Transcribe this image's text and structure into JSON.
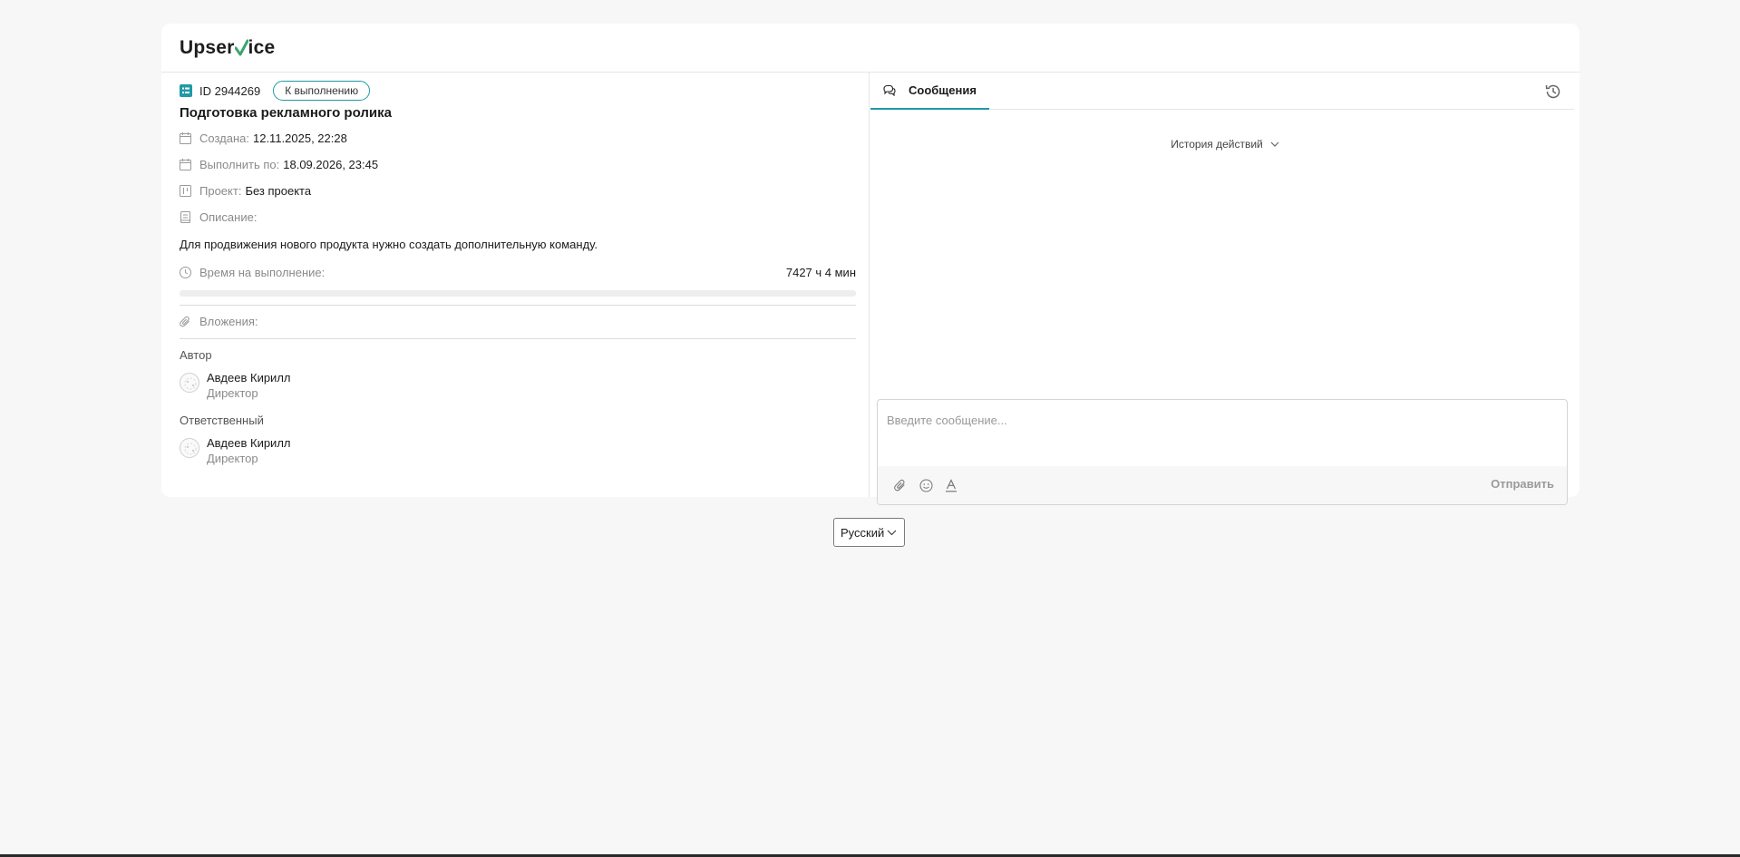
{
  "logo": {
    "text_before": "Upser",
    "text_after": "ice",
    "check_color": "#3aa76d"
  },
  "task": {
    "id_label": "ID 2944269",
    "status": "К выполнению",
    "title": "Подготовка рекламного ролика",
    "created_label": "Создана:",
    "created_value": "12.11.2025, 22:28",
    "due_label": "Выполнить по:",
    "due_value": "18.09.2026, 23:45",
    "project_label": "Проект:",
    "project_value": "Без проекта",
    "description_label": "Описание:",
    "description_text": "Для продвижения нового продукта нужно создать дополнительную команду.",
    "time_label": "Время на выполнение:",
    "time_value": "7427 ч 4 мин",
    "time_progress": 0,
    "attachments_label": "Вложения:"
  },
  "author": {
    "section_label": "Автор",
    "name": "Авдеев Кирилл",
    "role": "Директор"
  },
  "responsible": {
    "section_label": "Ответственный",
    "name": "Авдеев Кирилл",
    "role": "Директор"
  },
  "chat": {
    "tab_label": "Сообщения",
    "history_toggle": "История действий",
    "input_placeholder": "Введите сообщение...",
    "send_label": "Отправить"
  },
  "footer": {
    "language": "Русский"
  },
  "colors": {
    "accent": "#1f9aa6",
    "background": "#f7f7f7"
  }
}
